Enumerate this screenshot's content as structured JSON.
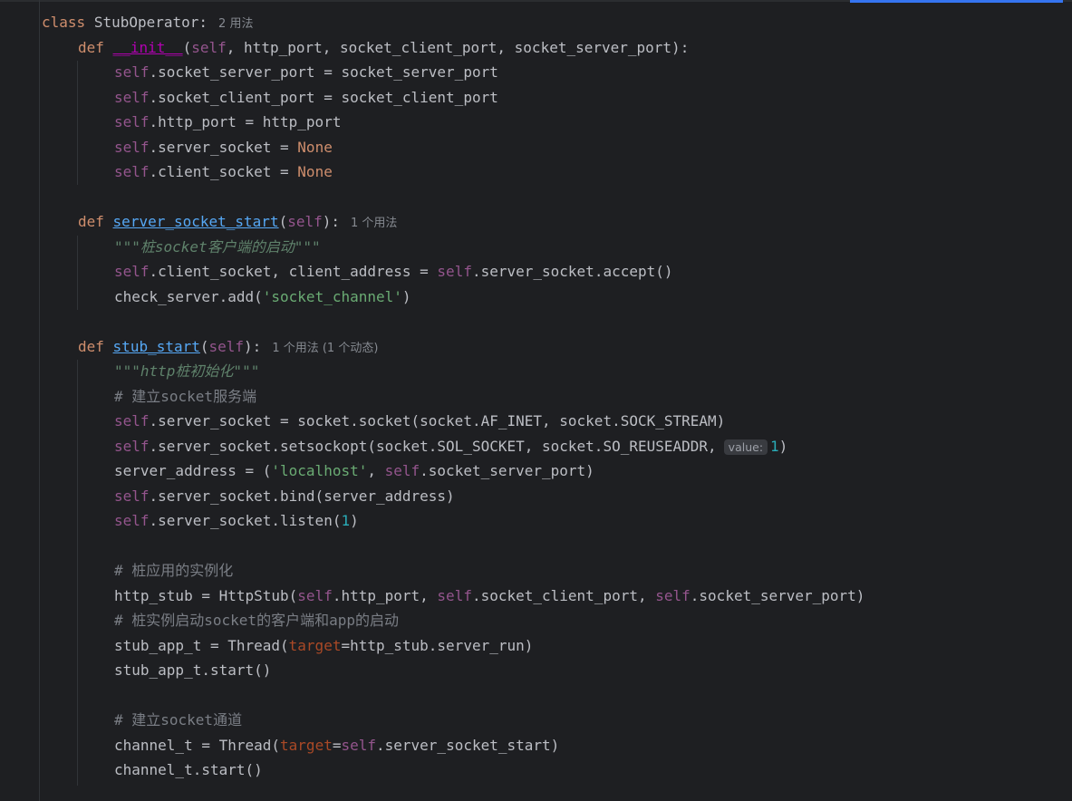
{
  "editor": {
    "accent_color": "#3574f0",
    "class_decl": {
      "keyword": "class",
      "name": "StubOperator",
      "colon": ":",
      "usage_hint": "2 用法"
    },
    "init": {
      "def": "def",
      "name": "__init__",
      "params_open": "(",
      "self": "self",
      "params_rest": ", http_port, socket_client_port, socket_server_port):",
      "body": [
        {
          "self": "self",
          "rest": ".socket_server_port = socket_server_port",
          "value": ""
        },
        {
          "self": "self",
          "rest": ".socket_client_port = socket_client_port",
          "value": ""
        },
        {
          "self": "self",
          "rest": ".http_port = http_port",
          "value": ""
        },
        {
          "self": "self",
          "rest": ".server_socket = ",
          "value": "None"
        },
        {
          "self": "self",
          "rest": ".client_socket = ",
          "value": "None"
        }
      ]
    },
    "server_socket_start": {
      "def": "def",
      "name": "server_socket_start",
      "params_open": "(",
      "self": "self",
      "params_close": "):",
      "usage_hint": "1 个用法",
      "docstring": "\"\"\"桩socket客户端的启动\"\"\"",
      "line2_self": "self",
      "line2_mid": ".client_socket, client_address = ",
      "line2_self2": "self",
      "line2_end": ".server_socket.accept()",
      "line3_start": "check_server.add(",
      "line3_str": "'socket_channel'",
      "line3_end": ")"
    },
    "stub_start": {
      "def": "def",
      "name": "stub_start",
      "params_open": "(",
      "self": "self",
      "params_close": "):",
      "usage_hint": "1 个用法 (1 个动态)",
      "docstring": "\"\"\"http桩初始化\"\"\"",
      "comment1": "# 建立socket服务端",
      "l_socket_self": "self",
      "l_socket_rest": ".server_socket = socket.socket(socket.AF_INET, socket.SOCK_STREAM)",
      "l_opt_self": "self",
      "l_opt_rest": ".server_socket.setsockopt(socket.SOL_SOCKET, socket.SO_REUSEADDR,",
      "l_opt_hint": "value:",
      "l_opt_num": "1",
      "l_opt_close": ")",
      "l_addr_start": "server_address = (",
      "l_addr_str": "'localhost'",
      "l_addr_mid": ", ",
      "l_addr_self": "self",
      "l_addr_end": ".socket_server_port)",
      "l_bind_self": "self",
      "l_bind_rest": ".server_socket.bind(server_address)",
      "l_listen_self": "self",
      "l_listen_rest": ".server_socket.listen(",
      "l_listen_num": "1",
      "l_listen_close": ")",
      "comment2": "# 桩应用的实例化",
      "l_stub_start": "http_stub = HttpStub(",
      "l_stub_self1": "self",
      "l_stub_p1": ".http_port, ",
      "l_stub_self2": "self",
      "l_stub_p2": ".socket_client_port, ",
      "l_stub_self3": "self",
      "l_stub_p3": ".socket_server_port)",
      "comment3": "# 桩实例启动socket的客户端和app的启动",
      "l_thread_start": "stub_app_t = Thread(",
      "l_thread_kw": "target",
      "l_thread_end": "=http_stub.server_run)",
      "l_thread_run": "stub_app_t.start()",
      "comment4": "# 建立socket通道",
      "l_chan_start": "channel_t = Thread(",
      "l_chan_kw": "target",
      "l_chan_eq": "=",
      "l_chan_self": "self",
      "l_chan_end": ".server_socket_start)",
      "l_chan_run": "channel_t.start()"
    }
  }
}
